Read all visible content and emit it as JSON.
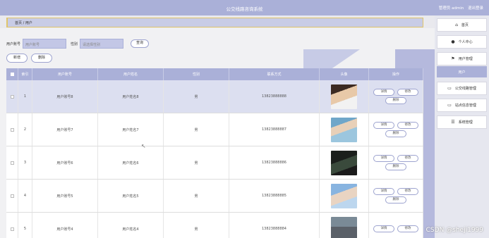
{
  "header": {
    "title": "公交线路咨询系统",
    "user_label": "管理员 admin",
    "logout": "退出登录"
  },
  "breadcrumb": {
    "text": "首页 / 用户"
  },
  "search": {
    "label_account": "用户账号",
    "placeholder_account": "用户账号",
    "label_gender": "性别",
    "placeholder_gender": "请选择性别",
    "button": "查询"
  },
  "actions": {
    "add": "新增",
    "delete": "删除"
  },
  "table": {
    "headers": [
      "索引",
      "用户账号",
      "用户姓名",
      "性别",
      "联系方式",
      "头像",
      "操作"
    ],
    "rows": [
      {
        "index": "1",
        "account": "用户账号8",
        "name": "用户姓名8",
        "gender": "男",
        "phone": "13823888888"
      },
      {
        "index": "2",
        "account": "用户账号7",
        "name": "用户姓名7",
        "gender": "男",
        "phone": "13823888887"
      },
      {
        "index": "3",
        "account": "用户账号6",
        "name": "用户姓名6",
        "gender": "男",
        "phone": "13823888886"
      },
      {
        "index": "4",
        "account": "用户账号5",
        "name": "用户姓名5",
        "gender": "男",
        "phone": "13823888885"
      },
      {
        "index": "5",
        "account": "用户账号4",
        "name": "用户姓名4",
        "gender": "男",
        "phone": "13823888884"
      }
    ],
    "ops": {
      "detail": "详情",
      "edit": "修改",
      "delete": "删除"
    }
  },
  "sidebar": {
    "home": "首页",
    "profile": "个人中心",
    "user_mgmt": "用户管理",
    "user_sub": "用户",
    "bus_route_mgmt": "公交线路管理",
    "station_mgmt": "站点信息管理",
    "system_mgmt": "系统管理"
  },
  "watermark": "CSDN @sheji1999"
}
